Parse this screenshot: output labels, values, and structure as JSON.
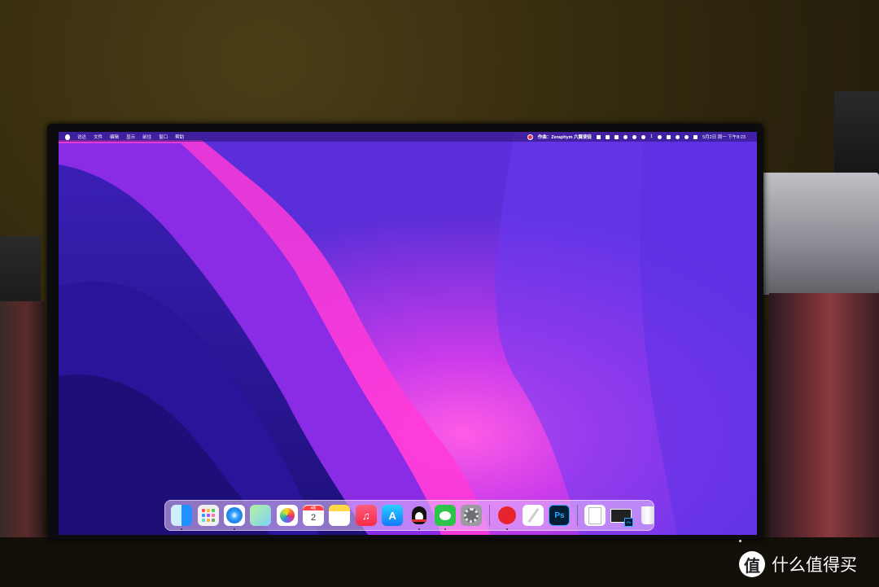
{
  "menubar": {
    "items": [
      "访达",
      "文件",
      "编辑",
      "显示",
      "前往",
      "窗口",
      "帮助"
    ],
    "now_playing": "作曲：Zeraphym 六翼使徒",
    "wechat_badge": "1",
    "datetime": "5月2日 周一 下午8:23"
  },
  "dock": {
    "apps": [
      {
        "name": "Finder",
        "icon": "finder-icon"
      },
      {
        "name": "Launchpad",
        "icon": "launchpad-icon"
      },
      {
        "name": "Safari",
        "icon": "safari-icon"
      },
      {
        "name": "Maps",
        "icon": "maps-icon"
      },
      {
        "name": "Photos",
        "icon": "photos-icon"
      },
      {
        "name": "Calendar",
        "icon": "calendar-icon"
      },
      {
        "name": "Notes",
        "icon": "notes-icon"
      },
      {
        "name": "Music",
        "icon": "music-icon"
      },
      {
        "name": "App Store",
        "icon": "app-store-icon"
      },
      {
        "name": "QQ",
        "icon": "qq-icon"
      },
      {
        "name": "WeChat",
        "icon": "wechat-icon"
      },
      {
        "name": "System Preferences",
        "icon": "settings-icon"
      },
      {
        "name": "NetEase Cloud Music",
        "icon": "netease-music-icon"
      },
      {
        "name": "Pencil",
        "icon": "pencil-icon"
      },
      {
        "name": "Photoshop",
        "icon": "photoshop-icon"
      },
      {
        "name": "Document",
        "icon": "document-icon"
      },
      {
        "name": "Screenshots",
        "icon": "screenshot-stack-icon"
      },
      {
        "name": "Trash",
        "icon": "trash-icon"
      }
    ],
    "calendar_month": "5月",
    "calendar_day": "2",
    "photoshop_label": "Ps"
  },
  "watermark": {
    "logo": "值",
    "text": "什么值得买"
  },
  "colors": {
    "wallpaper_deep": "#2a12a0",
    "wallpaper_pink": "#ff3ad8",
    "menubar_text": "#ffffff"
  }
}
